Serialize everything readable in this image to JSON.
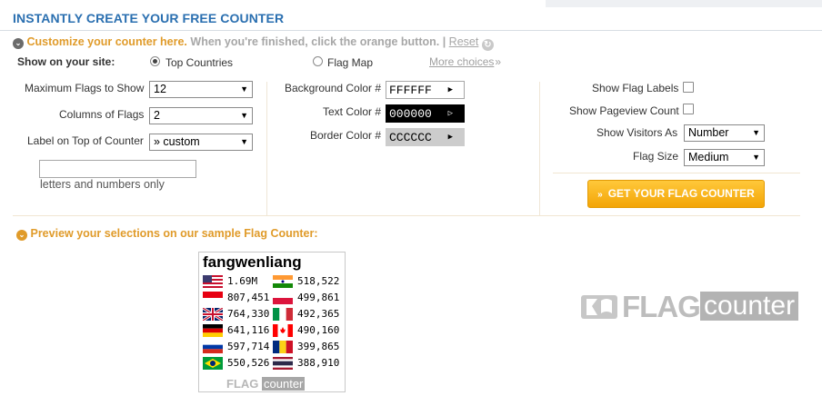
{
  "header": {
    "title": "INSTANTLY CREATE YOUR FREE COUNTER"
  },
  "subheader": {
    "lead": "Customize your counter here.",
    "rest": " When you're finished, click the orange button. | ",
    "reset_label": "Reset"
  },
  "show_on_site": {
    "label": "Show on your site:",
    "option_top": "Top Countries",
    "option_map": "Flag Map",
    "more_choices": "More choices",
    "more_arrow": "»"
  },
  "left_form": {
    "max_flags_label": "Maximum Flags to Show",
    "max_flags_value": "12",
    "columns_label": "Columns of Flags",
    "columns_value": "2",
    "label_top_label": "Label on Top of Counter",
    "label_top_value": "» custom",
    "custom_text_value": "",
    "hint": "letters and numbers only"
  },
  "colors": {
    "bg_label": "Background Color #",
    "bg_value": "FFFFFF",
    "text_label": "Text Color #",
    "text_value": "000000",
    "border_label": "Border Color #",
    "border_value": "CCCCCC"
  },
  "right_form": {
    "show_labels": "Show Flag Labels",
    "show_pageview": "Show Pageview Count",
    "visitors_as_label": "Show Visitors As",
    "visitors_as_value": "Number",
    "flag_size_label": "Flag Size",
    "flag_size_value": "Medium"
  },
  "button": {
    "label": "GET YOUR FLAG COUNTER"
  },
  "preview": {
    "label": "Preview your selections on our sample Flag Counter:",
    "counter_title": "fangwenliang",
    "rows": [
      {
        "left_flag": "us",
        "left": "1.69M",
        "right_flag": "in",
        "right": "518,522"
      },
      {
        "left_flag": "id",
        "left": "807,451",
        "right_flag": "pl",
        "right": "499,861"
      },
      {
        "left_flag": "gb",
        "left": "764,330",
        "right_flag": "it",
        "right": "492,365"
      },
      {
        "left_flag": "de",
        "left": "641,116",
        "right_flag": "ca",
        "right": "490,160"
      },
      {
        "left_flag": "ru",
        "left": "597,714",
        "right_flag": "ro",
        "right": "399,865"
      },
      {
        "left_flag": "br",
        "left": "550,526",
        "right_flag": "th",
        "right": "388,910"
      }
    ],
    "widget_logo_flag": "FLAG",
    "widget_logo_counter": "counter"
  },
  "logo": {
    "flag": "FLAG",
    "counter": "counter"
  },
  "colors_ui": {
    "accent": "#2a6fb0",
    "orange": "#e09b2a",
    "button": "#f5ac14"
  }
}
